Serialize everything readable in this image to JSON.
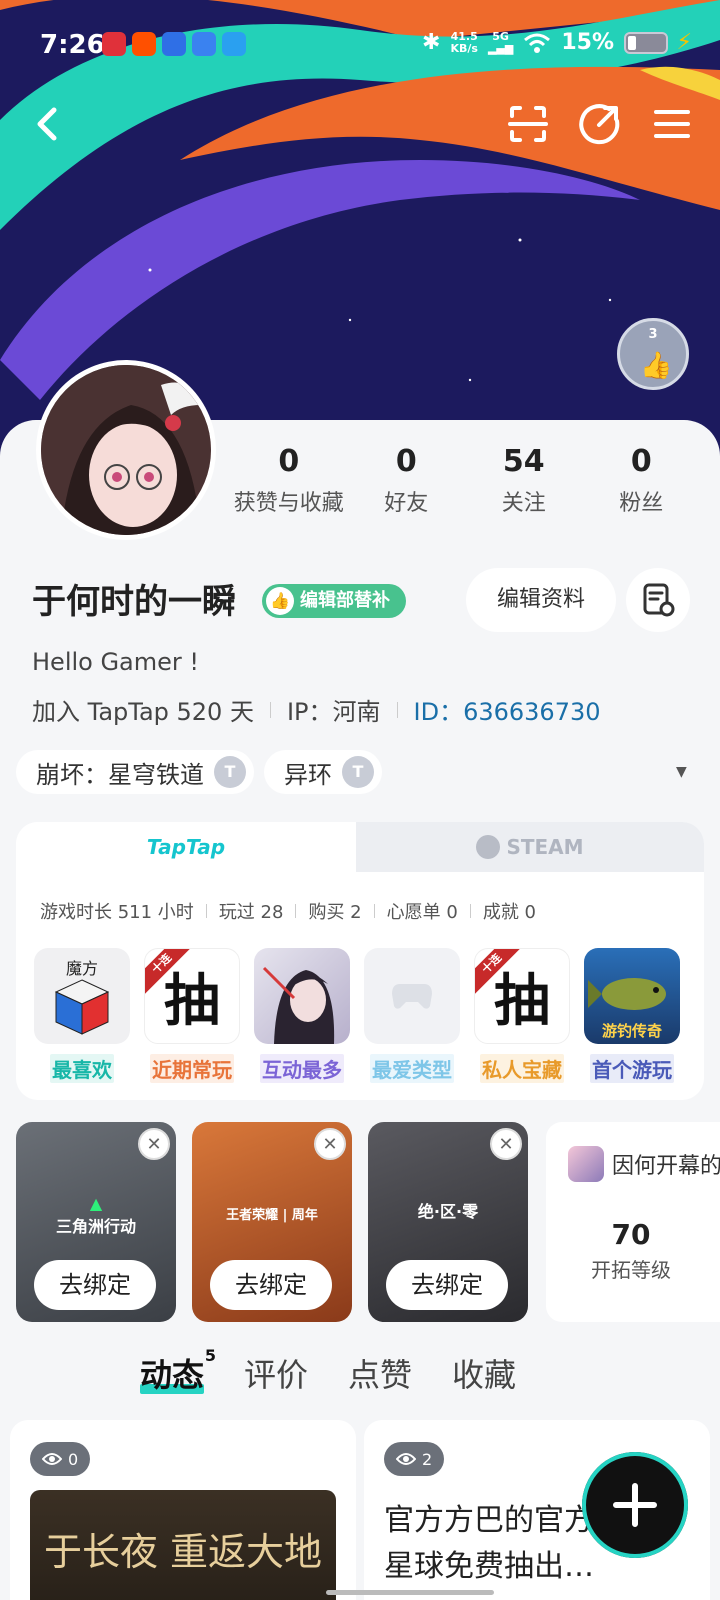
{
  "status_bar": {
    "time": "7:26",
    "net_speed": "41.5",
    "net_unit": "KB/s",
    "signal_label": "5G",
    "battery_percent": "15%"
  },
  "badge": {
    "count": "3"
  },
  "stats": [
    {
      "value": "0",
      "label": "获赞与收藏"
    },
    {
      "value": "0",
      "label": "好友"
    },
    {
      "value": "54",
      "label": "关注"
    },
    {
      "value": "0",
      "label": "粉丝"
    }
  ],
  "profile": {
    "name": "于何时的一瞬",
    "tag": "编辑部替补",
    "edit_label": "编辑资料",
    "bio": "Hello Gamer !",
    "joined": "加入 TapTap 520 天",
    "ip": "IP：河南",
    "id": "ID：636636730"
  },
  "chips": [
    {
      "label": "崩坏：星穹铁道"
    },
    {
      "label": "异环"
    }
  ],
  "games_card": {
    "tab_taptap": "TapTap",
    "tab_steam": "STEAM",
    "stats": [
      "游戏时长 511 小时",
      "玩过 28",
      "购买 2",
      "心愿单 0",
      "成就 0"
    ],
    "tiles": [
      {
        "label": "最喜欢",
        "color": "#18b7a8",
        "bg": "#e4f7f4",
        "art": "魔方"
      },
      {
        "label": "近期常玩",
        "color": "#e8743a",
        "bg": "#fdeee4",
        "art": "抽"
      },
      {
        "label": "互动最多",
        "color": "#7b64d6",
        "bg": "#efebfb",
        "art": ""
      },
      {
        "label": "最爱类型",
        "color": "#7ec6e8",
        "bg": "#eaf6fc",
        "art": ""
      },
      {
        "label": "私人宝藏",
        "color": "#e89a2a",
        "bg": "#fdf2e0",
        "art": "抽"
      },
      {
        "label": "首个游玩",
        "color": "#4a5ab8",
        "bg": "#e8ebf8",
        "art": "游钓传奇"
      }
    ],
    "ribbon_text": "十连"
  },
  "bound_games": [
    {
      "logo": "三角洲行动",
      "unbind": "去绑定"
    },
    {
      "logo": "王者荣耀 | 周年",
      "unbind": "去绑定"
    },
    {
      "logo": "绝·区·零",
      "unbind": "去绑定"
    }
  ],
  "rank_card": {
    "title": "因何开幕的",
    "value": "70",
    "label": "开拓等级"
  },
  "feed_tabs": [
    {
      "label": "动态",
      "count": "5"
    },
    {
      "label": "评价"
    },
    {
      "label": "点赞"
    },
    {
      "label": "收藏"
    }
  ],
  "posts": [
    {
      "views": "0",
      "image_title": "于长夜 重返大地"
    },
    {
      "views": "2",
      "text": "官方方巴的官方 1000星球免费抽出…"
    }
  ],
  "colors": {
    "accent": "#26d3c3",
    "taptap": "#15c5ce",
    "tag_green": "#48c28e",
    "id_blue": "#1a6fa8"
  }
}
